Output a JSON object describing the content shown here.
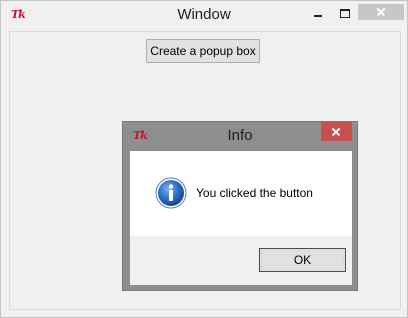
{
  "main_window": {
    "app_icon": "tk-feather-icon",
    "app_icon_text": "Tk",
    "title": "Window",
    "controls": [
      "minimize-icon",
      "maximize-icon",
      "close-icon"
    ],
    "popup_button_label": "Create a popup box"
  },
  "dialog": {
    "app_icon": "tk-feather-icon",
    "app_icon_text": "Tk",
    "title": "Info",
    "message_icon": "info-icon",
    "message": "You clicked the button",
    "ok_label": "OK",
    "colors": {
      "close_button": "#c75050",
      "frame": "#8e8e8e",
      "info_icon_blue": "#1a5fb4"
    }
  }
}
